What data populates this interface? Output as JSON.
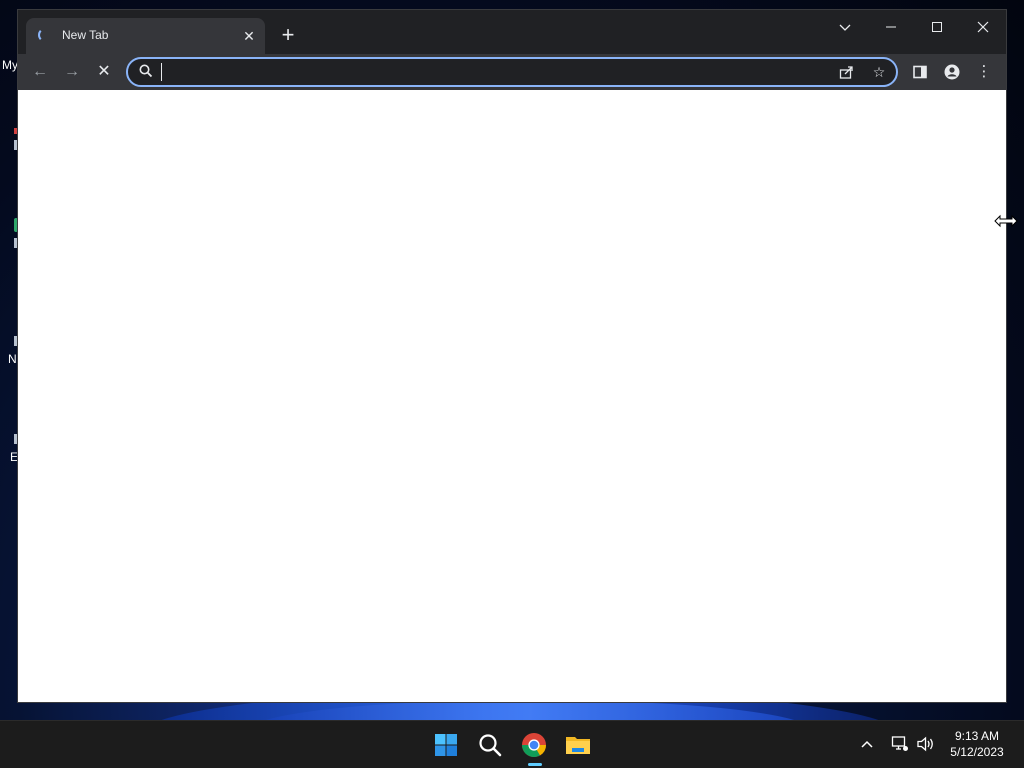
{
  "desktop": {
    "fragments": [
      "My",
      "N",
      "E"
    ]
  },
  "browser": {
    "tab": {
      "title": "New Tab",
      "close_glyph": "✕"
    },
    "new_tab_glyph": "+",
    "window_controls": {
      "tab_search_glyph": "⌄",
      "minimize_glyph": "—",
      "maximize_glyph": "☐",
      "close_glyph": "✕"
    },
    "toolbar": {
      "back_glyph": "←",
      "forward_glyph": "→",
      "stop_glyph": "✕",
      "omnibox": {
        "value": "",
        "placeholder": ""
      },
      "share_glyph": "⇪",
      "star_glyph": "☆",
      "menu_glyph": "⋮"
    }
  },
  "taskbar": {
    "tray_chevron": "^",
    "clock": {
      "time": "9:13 AM",
      "date": "5/12/2023"
    }
  },
  "icons": {
    "tab_spinner": "loading-spinner-icon",
    "omnibox_search": "search-icon",
    "side_panel": "side-panel-icon",
    "profile": "profile-icon",
    "start": "windows-start-icon",
    "taskbar_search": "search-icon",
    "chrome": "chrome-icon",
    "explorer": "file-explorer-icon",
    "network": "network-icon",
    "volume": "volume-icon",
    "resize_cursor": "horizontal-resize-cursor-icon"
  },
  "colors": {
    "accent": "#8ab4f8",
    "windows_accent": "#60cdff"
  }
}
